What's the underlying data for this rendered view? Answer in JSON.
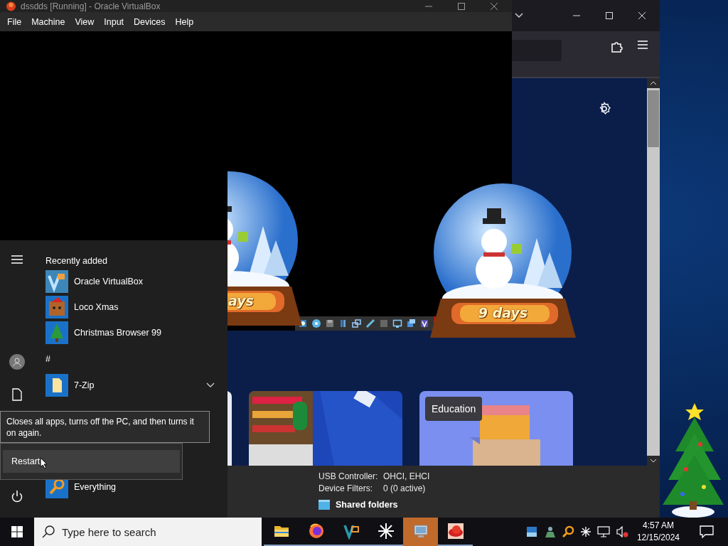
{
  "vbox_window": {
    "title": "dssdds [Running] - Oracle VirtualBox",
    "menu": [
      "File",
      "Machine",
      "View",
      "Input",
      "Devices",
      "Help"
    ]
  },
  "browser_window": {
    "cards": [
      {
        "kind": "picture"
      },
      {
        "kind": "picture"
      },
      {
        "kind": "picture",
        "label": "Education"
      }
    ]
  },
  "globes": [
    {
      "label": "ays"
    },
    {
      "label": "9 days"
    }
  ],
  "start_menu": {
    "groups": [
      {
        "header": "Recently added",
        "items": [
          {
            "label": "Oracle VirtualBox",
            "kind": "vbox",
            "expandable": false
          },
          {
            "label": "Loco Xmas",
            "kind": "dog",
            "expandable": false
          },
          {
            "label": "Christmas Browser 99",
            "kind": "tree",
            "expandable": false
          }
        ]
      },
      {
        "header": "#",
        "items": [
          {
            "label": "7-Zip",
            "kind": "zip",
            "expandable": true
          }
        ]
      },
      {
        "items": [
          {
            "label": "Everything",
            "kind": "search",
            "expandable": false
          }
        ]
      }
    ],
    "tooltip": "Closes all apps, turns off the PC, and then turns it on again.",
    "power_menu": [
      {
        "label": "Restart",
        "selected": true
      }
    ]
  },
  "details_panel": {
    "rows": [
      {
        "label": "USB Controller:",
        "value": "OHCI, EHCI"
      },
      {
        "label": "Device Filters:",
        "value": "0 (0 active)"
      }
    ],
    "section": "Shared folders"
  },
  "taskbar": {
    "search_placeholder": "Type here to search",
    "apps": [
      {
        "kind": "folder",
        "open": true,
        "selected": false
      },
      {
        "kind": "firefox",
        "open": true,
        "selected": false
      },
      {
        "kind": "vbox",
        "open": true,
        "selected": false
      },
      {
        "kind": "asterisk",
        "open": true,
        "selected": false
      },
      {
        "kind": "monitor",
        "open": true,
        "selected": true
      },
      {
        "kind": "hat",
        "open": true,
        "selected": false
      }
    ],
    "time": "4:57 AM",
    "date": "12/15/2024"
  }
}
